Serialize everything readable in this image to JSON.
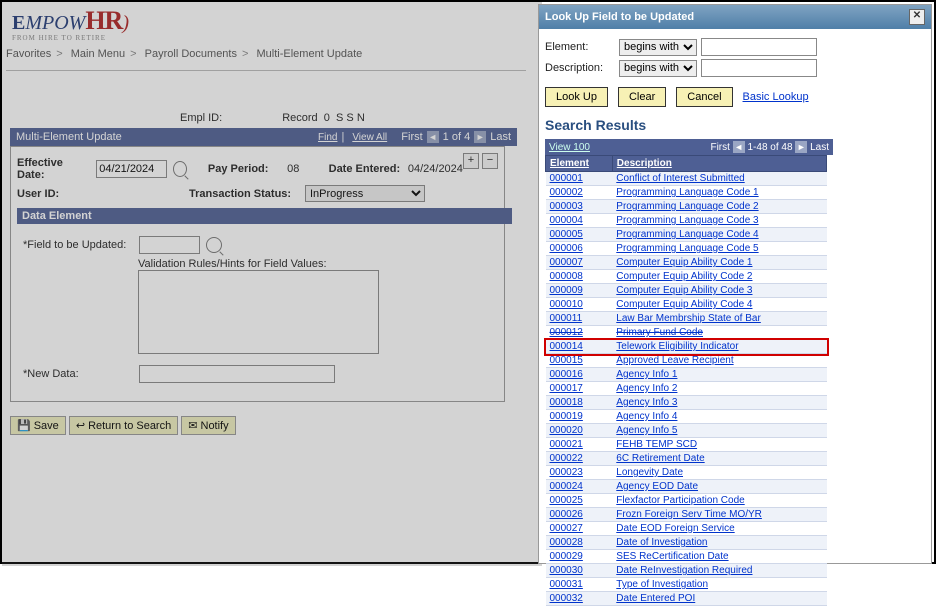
{
  "logo": {
    "line1": "EmpowHR",
    "sub": "FROM HIRE TO RETIRE"
  },
  "crumbs": [
    "Favorites",
    "Main Menu",
    "Payroll Documents",
    "Multi-Element Update"
  ],
  "hdr": {
    "emplid_lbl": "Empl ID:",
    "record_lbl": "Record",
    "record_val": "0",
    "ssn_lbl": "S S N"
  },
  "bar1": {
    "title": "Multi-Element Update",
    "find": "Find",
    "viewall": "View All",
    "first": "First",
    "count": "1 of 4",
    "last": "Last"
  },
  "form": {
    "effdate_lbl": "Effective Date:",
    "effdate_val": "04/21/2024",
    "payperiod_lbl": "Pay Period:",
    "payperiod_val": "08",
    "dateent_lbl": "Date Entered:",
    "dateent_val": "04/24/2024",
    "userid_lbl": "User ID:",
    "trans_lbl": "Transaction Status:",
    "trans_val": "InProgress",
    "subbar": "Data Element",
    "field_lbl": "*Field to be Updated:",
    "rules_lbl": "Validation Rules/Hints for Field Values:",
    "newdata_lbl": "*New Data:"
  },
  "buttons": {
    "save": "Save",
    "return": "Return to Search",
    "notify": "Notify"
  },
  "lookup": {
    "title": "Look Up Field to be Updated",
    "elem": "Element:",
    "desc": "Description:",
    "op": "begins with",
    "lookup": "Look Up",
    "clear": "Clear",
    "cancel": "Cancel",
    "basic": "Basic Lookup",
    "sr": "Search Results",
    "view100": "View 100",
    "first": "First",
    "range": "1-48 of 48",
    "last": "Last",
    "cols": {
      "el": "Element",
      "de": "Description"
    },
    "rows": [
      {
        "e": "000001",
        "d": "Conflict of Interest Submitted"
      },
      {
        "e": "000002",
        "d": "Programming Language Code 1"
      },
      {
        "e": "000003",
        "d": "Programming Language Code 2"
      },
      {
        "e": "000004",
        "d": "Programming Language Code 3"
      },
      {
        "e": "000005",
        "d": "Programming Language Code 4"
      },
      {
        "e": "000006",
        "d": "Programming Language Code 5"
      },
      {
        "e": "000007",
        "d": "Computer Equip Ability Code 1"
      },
      {
        "e": "000008",
        "d": "Computer Equip Ability Code 2"
      },
      {
        "e": "000009",
        "d": "Computer Equip Ability Code 3"
      },
      {
        "e": "000010",
        "d": "Computer Equip Ability Code 4"
      },
      {
        "e": "000011",
        "d": "Law Bar Membrship State of Bar"
      },
      {
        "e": "000012",
        "d": "Primary Fund Code",
        "strike": true
      },
      {
        "e": "000014",
        "d": "Telework Eligibility Indicator",
        "hl": true
      },
      {
        "e": "000015",
        "d": "Approved Leave Recipient"
      },
      {
        "e": "000016",
        "d": "Agency Info 1"
      },
      {
        "e": "000017",
        "d": "Agency Info 2"
      },
      {
        "e": "000018",
        "d": "Agency Info 3"
      },
      {
        "e": "000019",
        "d": "Agency Info 4"
      },
      {
        "e": "000020",
        "d": "Agency Info 5"
      },
      {
        "e": "000021",
        "d": "FEHB TEMP SCD"
      },
      {
        "e": "000022",
        "d": "6C Retirement Date"
      },
      {
        "e": "000023",
        "d": "Longevity Date"
      },
      {
        "e": "000024",
        "d": "Agency EOD Date"
      },
      {
        "e": "000025",
        "d": "Flexfactor Participation Code"
      },
      {
        "e": "000026",
        "d": "Frozn Foreign Serv Time MO/YR"
      },
      {
        "e": "000027",
        "d": "Date EOD Foreign Service"
      },
      {
        "e": "000028",
        "d": "Date of Investigation"
      },
      {
        "e": "000029",
        "d": "SES ReCertification Date"
      },
      {
        "e": "000030",
        "d": "Date ReInvestigation Required"
      },
      {
        "e": "000031",
        "d": "Type of Investigation"
      },
      {
        "e": "000032",
        "d": "Date Entered POI"
      }
    ]
  }
}
